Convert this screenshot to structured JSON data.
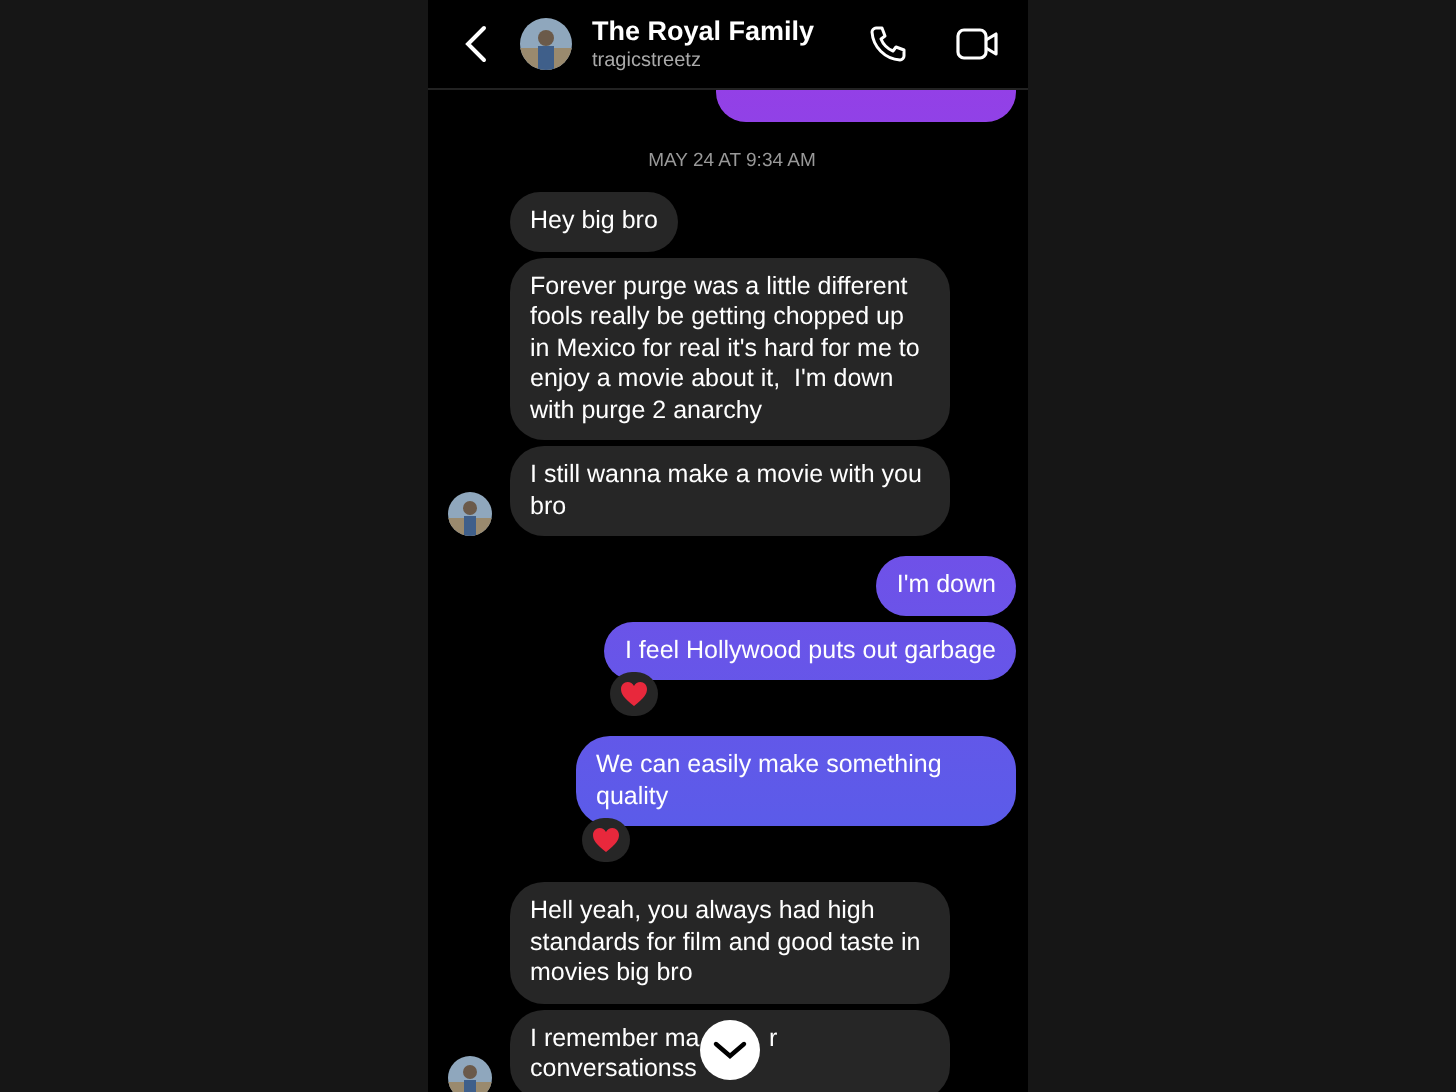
{
  "header": {
    "title": "The Royal Family",
    "subtitle": "tragicstreetz"
  },
  "messages": [
    {
      "kind": "sent",
      "reaction": false
    },
    {
      "kind": "timestamp",
      "text": "MAY 24 AT 9:34 AM"
    },
    {
      "kind": "received",
      "text": "Hey big bro",
      "avatar": false
    },
    {
      "kind": "received",
      "text": "Forever purge was a little different fools really be getting chopped up in Mexico for real it's hard for me to enjoy a movie about it,  I'm down with purge 2 anarchy",
      "avatar": false
    },
    {
      "kind": "received",
      "text": "I still wanna make a movie with you bro",
      "avatar": true
    },
    {
      "kind": "sent",
      "text": "I'm down",
      "reaction": false
    },
    {
      "kind": "sent",
      "text": "I feel Hollywood puts out garbage",
      "reaction": true
    },
    {
      "kind": "sent",
      "text": "We can easily make something quality",
      "reaction": true
    },
    {
      "kind": "received",
      "text": "Hell yeah, you always had high standards for film and good taste in movies big bro",
      "avatar": false
    },
    {
      "kind": "received",
      "text": "I remember ma          r conversationss",
      "avatar": true
    }
  ]
}
